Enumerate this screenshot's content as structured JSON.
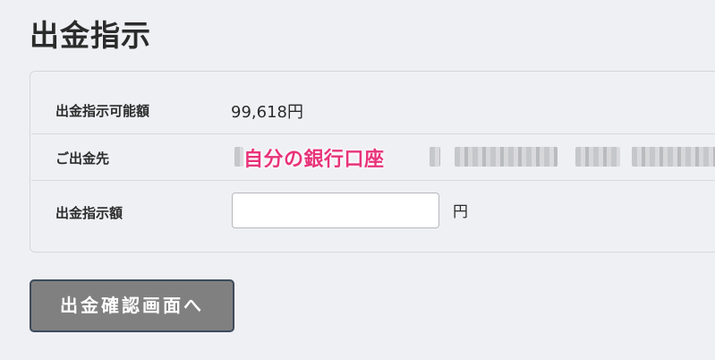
{
  "page": {
    "title": "出金指示"
  },
  "form": {
    "available": {
      "label": "出金指示可能額",
      "value": "99,618円"
    },
    "destination": {
      "label": "ご出金先",
      "annotation": "自分の銀行口座"
    },
    "amount": {
      "label": "出金指示額",
      "value": "",
      "placeholder": "",
      "unit": "円"
    }
  },
  "actions": {
    "submit_label": "出金確認画面へ"
  },
  "colors": {
    "background": "#eff0f4",
    "annotation": "#e8337a",
    "button": "#808080",
    "button_border": "#3c4a5c"
  }
}
